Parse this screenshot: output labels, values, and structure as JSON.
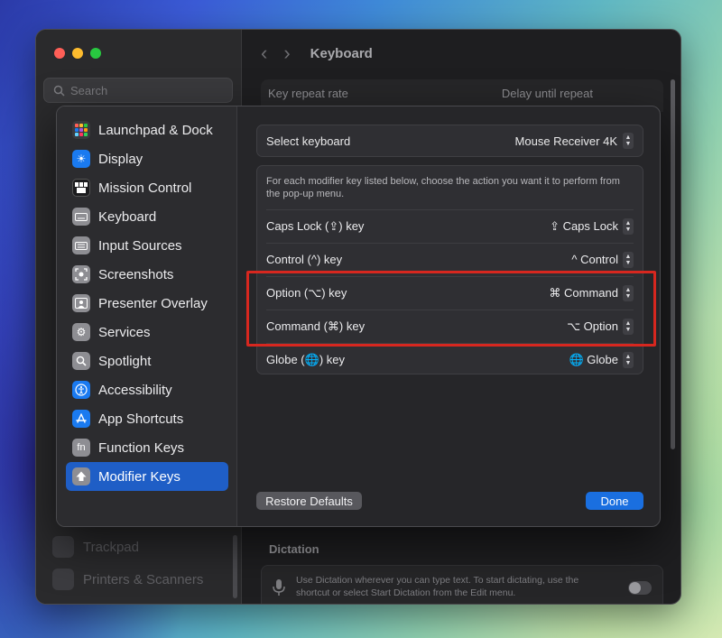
{
  "back_window": {
    "search_placeholder": "Search",
    "title": "Keyboard",
    "repeat_label": "Key repeat rate",
    "delay_label": "Delay until repeat",
    "bottom_items": [
      "Trackpad",
      "Printers & Scanners"
    ],
    "dictation_heading": "Dictation",
    "dictation_text": "Use Dictation wherever you can type text. To start dictating, use the shortcut or select Start Dictation from the Edit menu."
  },
  "sidebar": {
    "items": [
      {
        "label": "Launchpad & Dock",
        "icon": "launchpad-icon"
      },
      {
        "label": "Display",
        "icon": "display-icon"
      },
      {
        "label": "Mission Control",
        "icon": "mission-control-icon"
      },
      {
        "label": "Keyboard",
        "icon": "keyboard-icon"
      },
      {
        "label": "Input Sources",
        "icon": "input-sources-icon"
      },
      {
        "label": "Screenshots",
        "icon": "screenshots-icon"
      },
      {
        "label": "Presenter Overlay",
        "icon": "presenter-overlay-icon"
      },
      {
        "label": "Services",
        "icon": "services-icon"
      },
      {
        "label": "Spotlight",
        "icon": "spotlight-icon"
      },
      {
        "label": "Accessibility",
        "icon": "accessibility-icon"
      },
      {
        "label": "App Shortcuts",
        "icon": "app-shortcuts-icon"
      },
      {
        "label": "Function Keys",
        "icon": "function-keys-icon"
      },
      {
        "label": "Modifier Keys",
        "icon": "modifier-keys-icon"
      }
    ],
    "selected": "Modifier Keys"
  },
  "main": {
    "select_keyboard_label": "Select keyboard",
    "select_keyboard_value": "Mouse Receiver 4K",
    "description": "For each modifier key listed below, choose the action you want it to perform from the pop-up menu.",
    "rows": [
      {
        "key": "Caps Lock (⇪) key",
        "value": "⇪ Caps Lock"
      },
      {
        "key": "Control (^) key",
        "value": "^ Control"
      },
      {
        "key": "Option (⌥) key",
        "value": "⌘ Command"
      },
      {
        "key": "Command (⌘) key",
        "value": "⌥ Option"
      },
      {
        "key": "Globe (🌐) key",
        "value": "🌐 Globe"
      }
    ],
    "restore_label": "Restore Defaults",
    "done_label": "Done"
  },
  "colors": {
    "accent": "#1f5ec6",
    "highlight": "#d7271f",
    "done_button": "#1a6fe0"
  }
}
